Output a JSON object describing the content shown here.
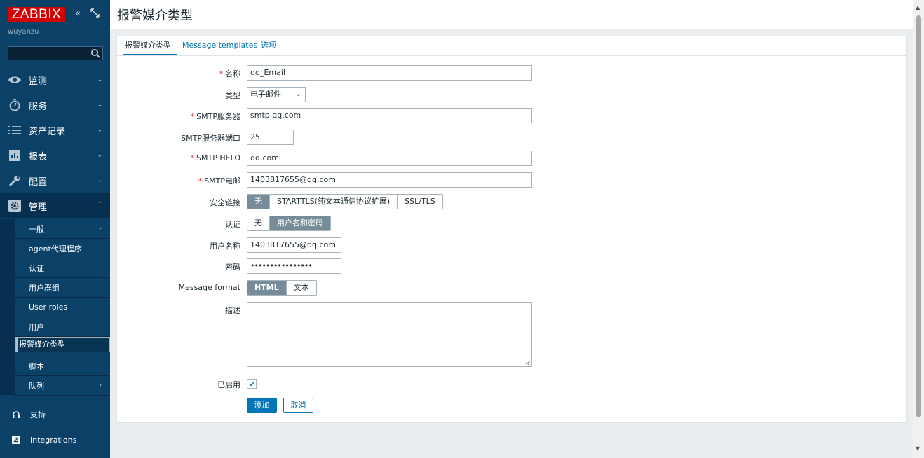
{
  "brand": {
    "logo": "ZABBIX",
    "user": "wuyanzu"
  },
  "sidebar": {
    "menu": [
      {
        "label": "监测",
        "icon": "eye-icon"
      },
      {
        "label": "服务",
        "icon": "stopwatch-icon"
      },
      {
        "label": "资产记录",
        "icon": "list-icon"
      },
      {
        "label": "报表",
        "icon": "bar-chart-icon"
      },
      {
        "label": "配置",
        "icon": "wrench-icon"
      },
      {
        "label": "管理",
        "icon": "gear-icon"
      }
    ],
    "submenu": [
      {
        "label": "一般"
      },
      {
        "label": "agent代理程序"
      },
      {
        "label": "认证"
      },
      {
        "label": "用户群组"
      },
      {
        "label": "User roles"
      },
      {
        "label": "用户"
      },
      {
        "label": "报警媒介类型"
      },
      {
        "label": "脚本"
      },
      {
        "label": "队列"
      }
    ],
    "footer": [
      {
        "label": "支持",
        "icon": "headset-icon"
      },
      {
        "label": "Integrations",
        "icon": "zabbix-z-icon"
      }
    ]
  },
  "header": {
    "title": "报警媒介类型"
  },
  "tabs": [
    "报警媒介类型",
    "Message templates",
    "选项"
  ],
  "form": {
    "name": {
      "label": "名称",
      "value": "qq_Email"
    },
    "type": {
      "label": "类型",
      "value": "电子邮件"
    },
    "smtp_server": {
      "label": "SMTP服务器",
      "value": "smtp.qq.com"
    },
    "smtp_port": {
      "label": "SMTP服务器端口",
      "value": "25"
    },
    "smtp_helo": {
      "label": "SMTP HELO",
      "value": "qq.com"
    },
    "smtp_email": {
      "label": "SMTP电邮",
      "value": "1403817655@qq.com"
    },
    "security": {
      "label": "安全链接",
      "options": [
        "无",
        "STARTTLS(纯文本通信协议扩展)",
        "SSL/TLS"
      ],
      "selected": "无"
    },
    "auth": {
      "label": "认证",
      "options": [
        "无",
        "用户名和密码"
      ],
      "selected": "用户名和密码"
    },
    "username": {
      "label": "用户名称",
      "value": "1403817655@qq.com"
    },
    "password": {
      "label": "密码",
      "value": "••••••••••••••••"
    },
    "message_format": {
      "label": "Message format",
      "options": [
        "HTML",
        "文本"
      ],
      "selected": "HTML"
    },
    "description": {
      "label": "描述",
      "value": ""
    },
    "enabled": {
      "label": "已启用",
      "checked": true
    },
    "buttons": {
      "add": "添加",
      "cancel": "取消"
    }
  },
  "colors": {
    "sidebar": "#0b4167",
    "accent": "#0275b8",
    "logo": "#d40000",
    "required": "#e33734"
  }
}
